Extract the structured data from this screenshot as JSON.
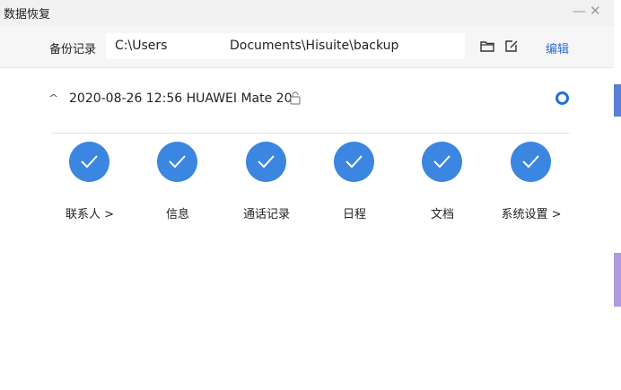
{
  "window": {
    "title": "数据恢复",
    "minimize_glyph": "—",
    "close_glyph": "✕"
  },
  "path_bar": {
    "label": "备份记录",
    "path_start": "C:\\Users",
    "path_end": "Documents\\Hisuite\\backup",
    "folder_icon": "folder-icon",
    "edit_icon": "edit-icon",
    "edit_link": "编辑"
  },
  "backup": {
    "chevron": "^",
    "title": "2020-08-26 12:56 HUAWEI Mate 20",
    "lock_icon": "lock-icon"
  },
  "categories": [
    {
      "label": "联系人 >"
    },
    {
      "label": "信息"
    },
    {
      "label": "通话记录"
    },
    {
      "label": "日程"
    },
    {
      "label": "文档"
    },
    {
      "label": "系统设置 >"
    }
  ],
  "colors": {
    "accent": "#3b86e0",
    "link": "#2d6fd2"
  }
}
